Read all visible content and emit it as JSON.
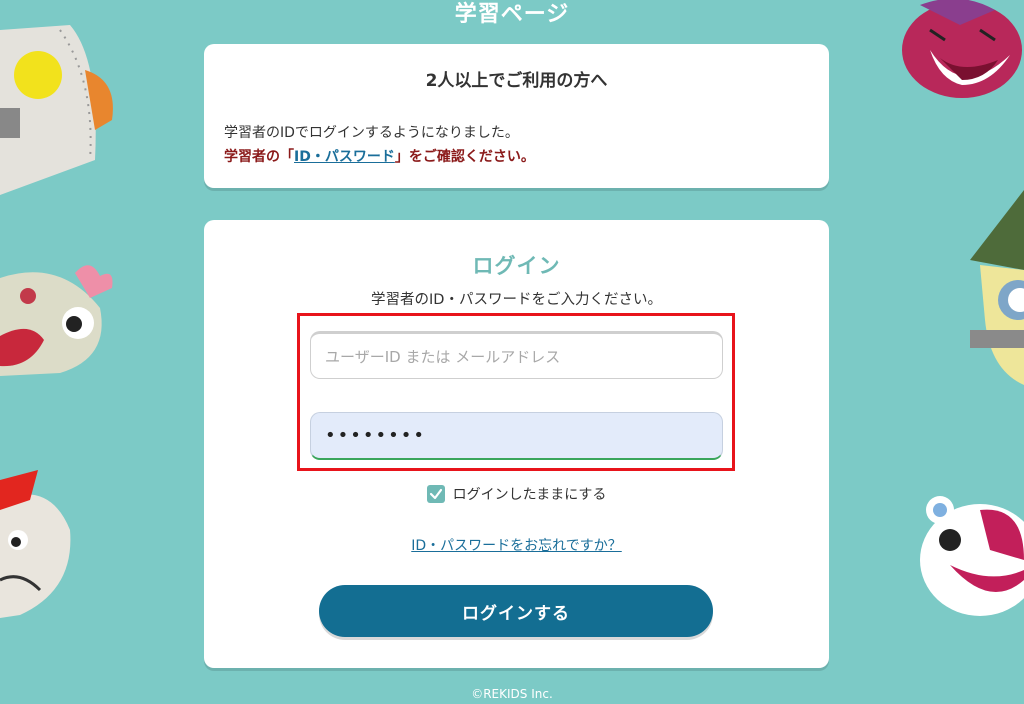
{
  "header": {
    "title": "学習ページ"
  },
  "notice": {
    "title": "2人以上でご利用の方へ",
    "line1": "学習者のIDでログインするようになりました。",
    "line2_prefix": "学習者の「",
    "line2_link": "ID・パスワード",
    "line2_suffix": "」をご確認ください。"
  },
  "login": {
    "heading": "ログイン",
    "instruction": "学習者のID・パスワードをご入力ください。",
    "username_placeholder": "ユーザーID または メールアドレス",
    "password_value": "••••••••",
    "remember_label": "ログインしたままにする",
    "remember_checked": true,
    "forgot_link": "ID・パスワードをお忘れですか？",
    "submit_label": "ログインする"
  },
  "footer": {
    "copyright": "©REKIDS Inc."
  },
  "colors": {
    "background": "#7ccac6",
    "accent": "#6fb9b5",
    "button": "#136e92",
    "notice_red": "#8b1a1a",
    "highlight": "#e8141b"
  },
  "icons": {
    "checkbox": "check-icon"
  }
}
